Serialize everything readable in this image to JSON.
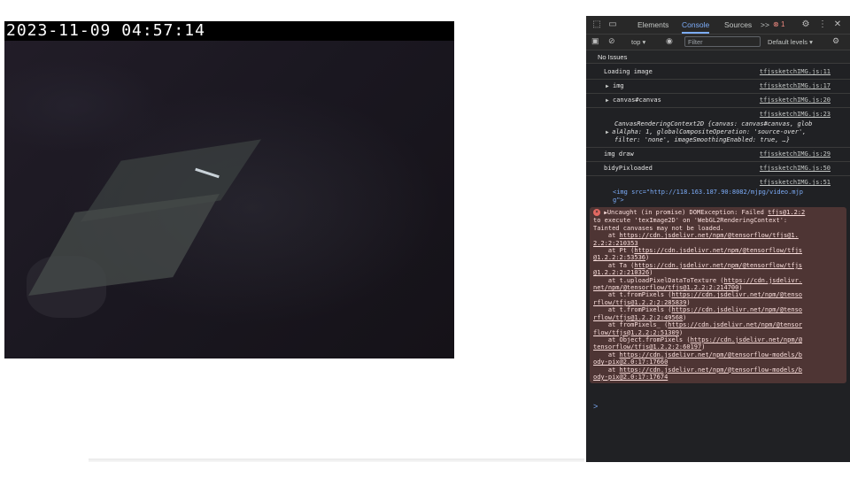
{
  "camera": {
    "timestamp": "2023-11-09  04:57:14"
  },
  "devtools": {
    "tabs": [
      "Elements",
      "Console",
      "Sources"
    ],
    "more_tabs": ">>",
    "error_count": "1",
    "context": "top",
    "filter_placeholder": "Filter",
    "levels": "Default levels",
    "issues": "No Issues",
    "prompt": ">",
    "console_rows": [
      {
        "text": "Loading image",
        "src": "tfjssketchIMG.js:11"
      },
      {
        "text": "img",
        "src": "tfjssketchIMG.js:17"
      },
      {
        "text": "canvas#canvas",
        "src": "tfjssketchIMG.js:20"
      },
      {
        "text_a": "CanvasRenderingContext2D {canvas: canvas#canvas, glob",
        "text_b": "alAlpha: 1, globalCompositeOperation: 'source-over',",
        "text_c": "filter: 'none', imageSmoothingEnabled: true, …}",
        "src": "tfjssketchIMG.js:23"
      },
      {
        "text": "img draw",
        "src": "tfjssketchIMG.js:29"
      },
      {
        "text": "bidyPixloaded",
        "src": "tfjssketchIMG.js:50"
      },
      {
        "text_a": "<img src=\"http://118.163.187.90:8082/mjpg/video.mjp",
        "text_b": "g\">",
        "src": "tfjssketchIMG.js:51"
      }
    ],
    "error": {
      "head": "Uncaught (in promise) DOMException: Failed",
      "head_src": "tfjs@1.2:2",
      "lines": [
        "to execute 'texImage2D' on 'WebGL2RenderingContext':",
        "Tainted canvases may not be loaded."
      ],
      "stack": [
        {
          "pre": "    at ",
          "link": "https://cdn.jsdelivr.net/npm/@tensorflow/tfjs@1.",
          "link2": "2.2:2:210353",
          "post": ""
        },
        {
          "pre": "    at Pt (",
          "link": "https://cdn.jsdelivr.net/npm/@tensorflow/tfjs",
          "link2": "@1.2.2:2:53536",
          "post": ")"
        },
        {
          "pre": "    at Ta (",
          "link": "https://cdn.jsdelivr.net/npm/@tensorflow/tfjs",
          "link2": "@1.2.2:2:210326",
          "post": ")"
        },
        {
          "pre": "    at t.uploadPixelDataToTexture (",
          "link": "https://cdn.jsdelivr.",
          "link2": "net/npm/@tensorflow/tfjs@1.2.2:2:214700",
          "post": ")"
        },
        {
          "pre": "    at t.fromPixels (",
          "link": "https://cdn.jsdelivr.net/npm/@tenso",
          "link2": "rflow/tfjs@1.2.2:2:285839",
          "post": ")"
        },
        {
          "pre": "    at t.fromPixels (",
          "link": "https://cdn.jsdelivr.net/npm/@tenso",
          "link2": "rflow/tfjs@1.2.2:2:49568",
          "post": ")"
        },
        {
          "pre": "    at fromPixels_ (",
          "link": "https://cdn.jsdelivr.net/npm/@tensor",
          "link2": "flow/tfjs@1.2.2:2:51309",
          "post": ")"
        },
        {
          "pre": "    at Object.fromPixels (",
          "link": "https://cdn.jsdelivr.net/npm/@",
          "link2": "tensorflow/tfjs@1.2.2:2:60197",
          "post": ")"
        },
        {
          "pre": "    at ",
          "link": "https://cdn.jsdelivr.net/npm/@tensorflow-models/b",
          "link2": "ody-pix@2.0:17:17660",
          "post": ""
        },
        {
          "pre": "    at ",
          "link": "https://cdn.jsdelivr.net/npm/@tensorflow-models/b",
          "link2": "ody-pix@2.0:17:17674",
          "post": ""
        }
      ]
    }
  }
}
